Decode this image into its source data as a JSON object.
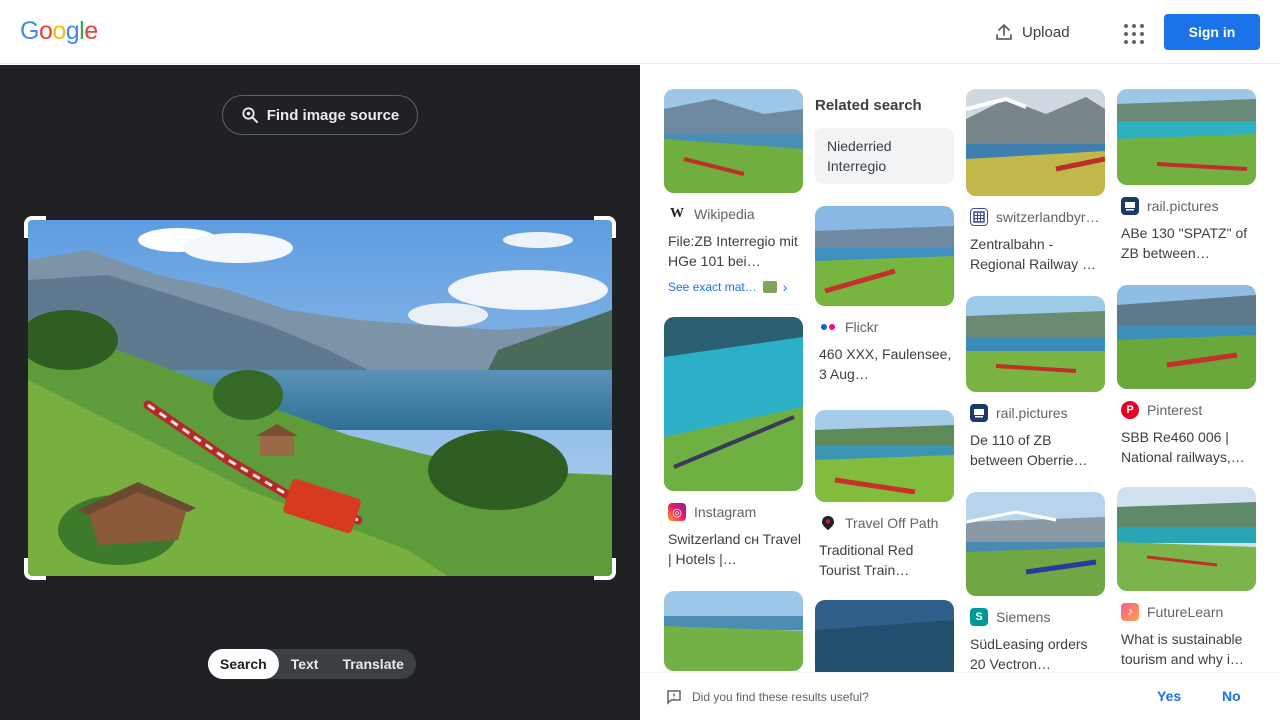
{
  "header": {
    "logo_letters": [
      {
        "ch": "G",
        "color": "#4285f4"
      },
      {
        "ch": "o",
        "color": "#ea4335"
      },
      {
        "ch": "o",
        "color": "#fbbc05"
      },
      {
        "ch": "g",
        "color": "#4285f4"
      },
      {
        "ch": "l",
        "color": "#34a853"
      },
      {
        "ch": "e",
        "color": "#ea4335"
      }
    ],
    "upload_label": "Upload",
    "signin_label": "Sign in"
  },
  "left": {
    "find_source_label": "Find image source",
    "modes": [
      "Search",
      "Text",
      "Translate"
    ],
    "active_mode": "Search"
  },
  "results": {
    "col1": [
      {
        "source": "Wikipedia",
        "icon": "wikipedia-icon",
        "title": "File:ZB Interregio mit HGe 101 bei…",
        "see_exact": "See exact mat…"
      },
      {
        "source": "Instagram",
        "icon": "instagram-icon",
        "title": "Switzerland ᴄʜ Travel | Hotels |…"
      }
    ],
    "related": {
      "heading": "Related search",
      "chip": "Niederried Interregio"
    },
    "col2": [
      {
        "source": "Flickr",
        "icon": "flickr-icon",
        "title": "460 XXX, Faulensee, 3 Aug…"
      },
      {
        "source": "Travel Off Path",
        "icon": "travel-off-path-icon",
        "title": "Traditional Red Tourist Train…"
      }
    ],
    "col3": [
      {
        "source": "switzerlandbyr…",
        "icon": "switzerlandbyrail-icon",
        "title": "Zentralbahn - Regional Railway …"
      },
      {
        "source": "rail.pictures",
        "icon": "rail-pictures-icon",
        "title": "De 110 of ZB between Oberrie…"
      },
      {
        "source": "Siemens",
        "icon": "siemens-icon",
        "title": "SüdLeasing orders 20 Vectron…"
      }
    ],
    "col4": [
      {
        "source": "rail.pictures",
        "icon": "rail-pictures-icon",
        "title": "ABe 130 \"SPATZ\" of ZB between…"
      },
      {
        "source": "Pinterest",
        "icon": "pinterest-icon",
        "title": "SBB Re460 006 | National railways,…"
      },
      {
        "source": "FutureLearn",
        "icon": "futurelearn-icon",
        "title": "What is sustainable tourism and why i…"
      }
    ]
  },
  "footer": {
    "question": "Did you find these results useful?",
    "yes_label": "Yes",
    "no_label": "No"
  }
}
